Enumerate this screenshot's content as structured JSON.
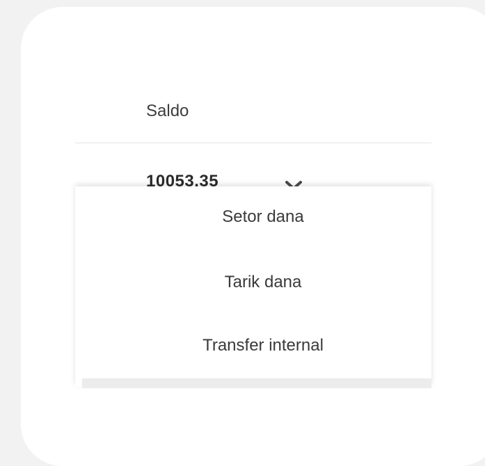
{
  "balance": {
    "label": "Saldo",
    "value": "10053.35"
  },
  "dropdown": {
    "items": [
      {
        "label": "Setor dana"
      },
      {
        "label": "Tarik dana"
      },
      {
        "label": "Transfer internal"
      }
    ]
  },
  "icons": {
    "expand": "chevron-down-icon"
  },
  "colors": {
    "background": "#f2f2f2",
    "card": "#ffffff",
    "text": "#3a3a3a"
  }
}
